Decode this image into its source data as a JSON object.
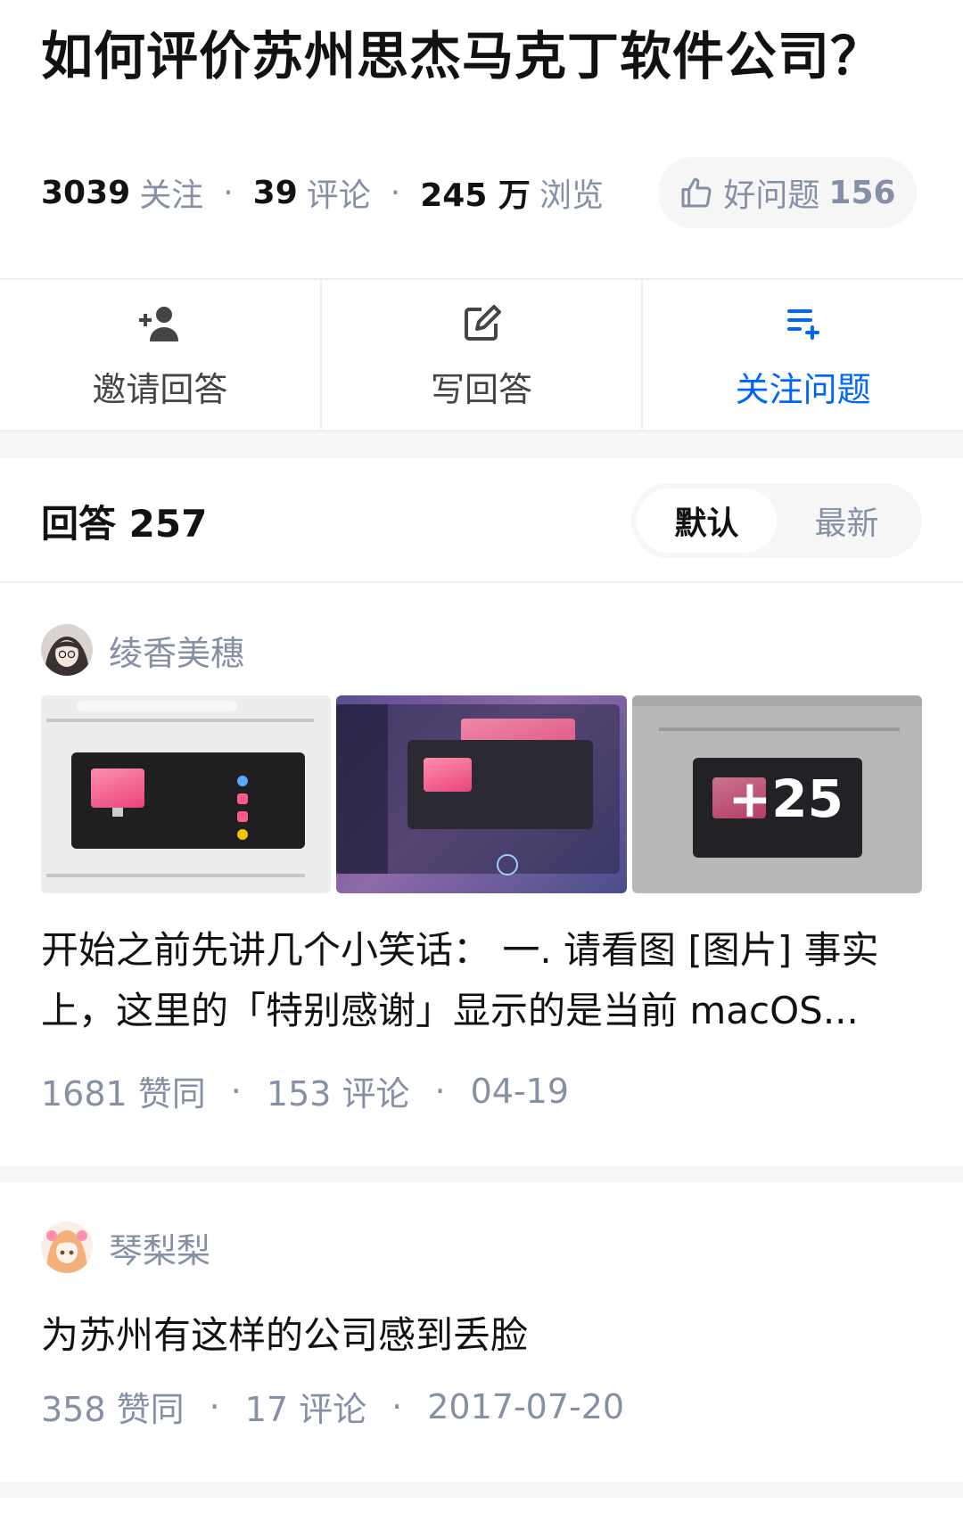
{
  "question": {
    "title": "如何评价苏州思杰马克丁软件公司？",
    "follow_count": "3039",
    "follow_label": "关注",
    "comment_count": "39",
    "comment_label": "评论",
    "view_count": "245 万",
    "view_label": "浏览",
    "good_label": "好问题",
    "good_count": "156"
  },
  "actions": [
    {
      "label": "邀请回答",
      "icon": "add-user-icon"
    },
    {
      "label": "写回答",
      "icon": "edit-icon"
    },
    {
      "label": "关注问题",
      "icon": "add-list-icon"
    }
  ],
  "answers_header": {
    "label": "回答 257",
    "sort_options": [
      "默认",
      "最新"
    ],
    "active_sort": "默认"
  },
  "answers": [
    {
      "author": "绫香美穗",
      "images": [
        "screenshot-1",
        "screenshot-2",
        "screenshot-3"
      ],
      "image_more": "+25",
      "excerpt": "开始之前先讲几个小笑话： 一. 请看图 [图片] 事实上，这里的「特别感谢」显示的是当前 macOS...",
      "likes": "1681 赞同",
      "comments": "153 评论",
      "date": "04-19"
    },
    {
      "author": "琴梨梨",
      "excerpt": "为苏州有这样的公司感到丢脸",
      "likes": "358 赞同",
      "comments": "17 评论",
      "date": "2017-07-20"
    }
  ],
  "colors": {
    "accent_blue": "#0066ff",
    "meta_gray": "#8590a6",
    "text_dark": "#121212",
    "divider": "#f0f0f0"
  }
}
